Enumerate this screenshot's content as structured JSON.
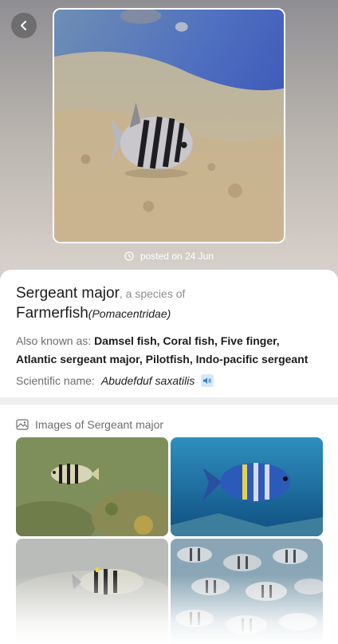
{
  "header": {
    "back_icon": "chevron-left-icon",
    "posted_icon": "clock-icon",
    "posted_text": "posted on 24 Jun"
  },
  "species": {
    "common_name": "Sergeant major",
    "species_prefix": ", a species of",
    "family": "Farmerfish",
    "family_scientific": "(Pomacentridae)",
    "aka_label": "Also known as:",
    "aka_values": "Damsel fish, Coral fish, Five finger, Atlantic sergeant major, Pilotfish, Indo-pacific sergeant",
    "scientific_label": "Scientific name:",
    "scientific_value": "Abudefduf saxatilis",
    "speaker_icon": "speaker-icon"
  },
  "images": {
    "header_icon": "image-gallery-icon",
    "title": "Images of Sergeant major"
  },
  "colors": {
    "divider": "#efeff2",
    "muted_text": "#6d6d72",
    "primary_text": "#1c1c1e"
  }
}
